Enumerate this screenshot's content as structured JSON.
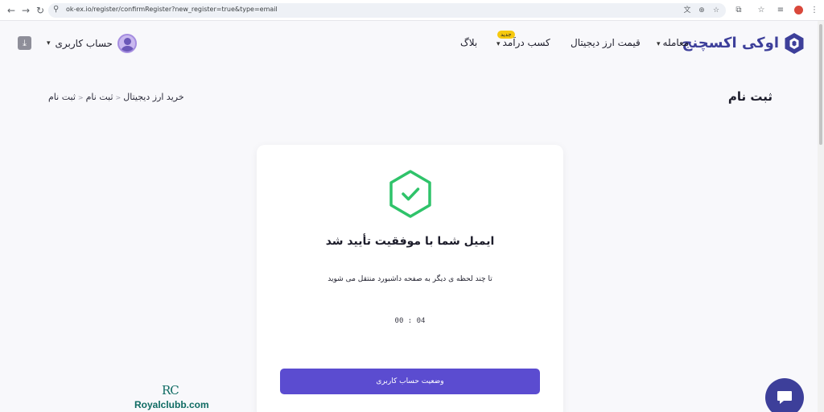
{
  "browser": {
    "url": "ok-ex.io/register/confirmRegister?new_register=true&type=email"
  },
  "header": {
    "logo_text": "اوکی اکسچنج",
    "menu": {
      "trade": "معامله",
      "prices": "قیمت ارز دیجیتال",
      "earn": "کسب درآمد",
      "earn_badge": "جدید",
      "blog": "بلاگ"
    },
    "account_label": "حساب کاربری"
  },
  "page": {
    "title": "ثبت نام",
    "breadcrumb": [
      "خرید ارز دیجیتال",
      "ثبت نام",
      "ثبت نام"
    ]
  },
  "card": {
    "heading": "ایمیل شما با موفقیت تأیید شد",
    "message": "تا چند لحظه ی دیگر به صفحه داشبورد منتقل می شوید",
    "countdown": "00 : 04",
    "button_label": "وضعیت حساب کاربری"
  },
  "watermark": {
    "mark": "RC",
    "text": "Royalclubb.com"
  },
  "colors": {
    "brand": "#3d3f9a",
    "primary_button": "#5b4cd0",
    "success": "#2fc36a",
    "badge": "#f6c90e"
  }
}
